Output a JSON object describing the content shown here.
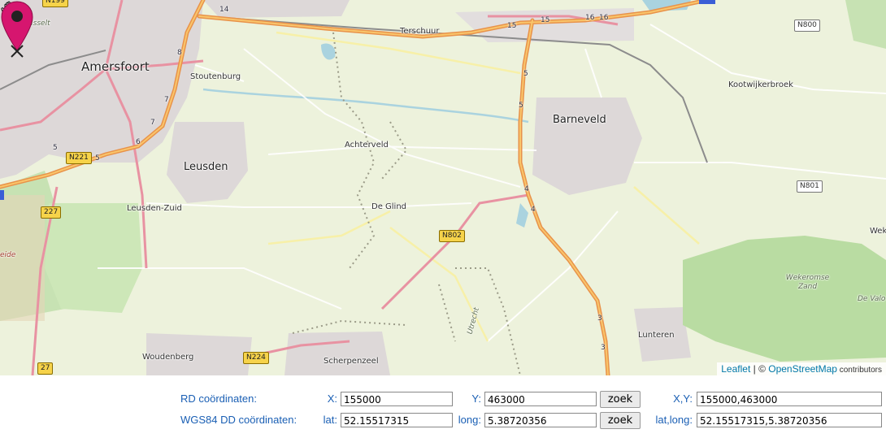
{
  "map": {
    "places": {
      "amersfoort": "Amersfoort",
      "isselt": "Isselt",
      "terschuur": "Terschuur",
      "stoutenburg": "Stoutenburg",
      "kootwijkerbroek": "Kootwijkerbroek",
      "barneveld": "Barneveld",
      "achterveld": "Achterveld",
      "leusden": "Leusden",
      "leusden_zuid": "Leusden-Zuid",
      "de_glind": "De Glind",
      "woudenberg": "Woudenberg",
      "scherpenzeel": "Scherpenzeel",
      "lunteren": "Lunteren",
      "wekeromse_zand": "Wekeromse Zand",
      "de_valo": "De Valo",
      "heide": "eide",
      "utrecht": "Utrecht",
      "wek": "Wek"
    },
    "road_labels": {
      "n800": "N800",
      "n801": "N801",
      "n221": "N221",
      "n802": "N802",
      "n224": "N224",
      "n227": "227",
      "n199": "N199",
      "n27b": "27"
    },
    "exit_numbers": [
      "14",
      "15",
      "15",
      "16",
      "16",
      "5",
      "5",
      "4",
      "4",
      "3",
      "3",
      "8",
      "7",
      "7",
      "6",
      "5",
      "5"
    ],
    "marker_color": "#d6166f",
    "attribution": {
      "leaflet": "Leaflet",
      "separator": " | © ",
      "osm": "OpenStreetMap",
      "contributors": " contributors"
    }
  },
  "form": {
    "rd_label": "RD coördinaten:",
    "x_label": "X:",
    "x_value": "155000",
    "y_label": "Y:",
    "y_value": "463000",
    "zoek_label": "zoek",
    "xy_label": "X,Y:",
    "xy_value": "155000,463000",
    "wgs_label": "WGS84 DD coördinaten:",
    "lat_label": "lat:",
    "lat_value": "52.15517315",
    "long_label": "long:",
    "long_value": "5.38720356",
    "latlong_label": "lat,long:",
    "latlong_value": "52.15517315,5.38720356",
    "label_color": "#1a5fb4"
  }
}
